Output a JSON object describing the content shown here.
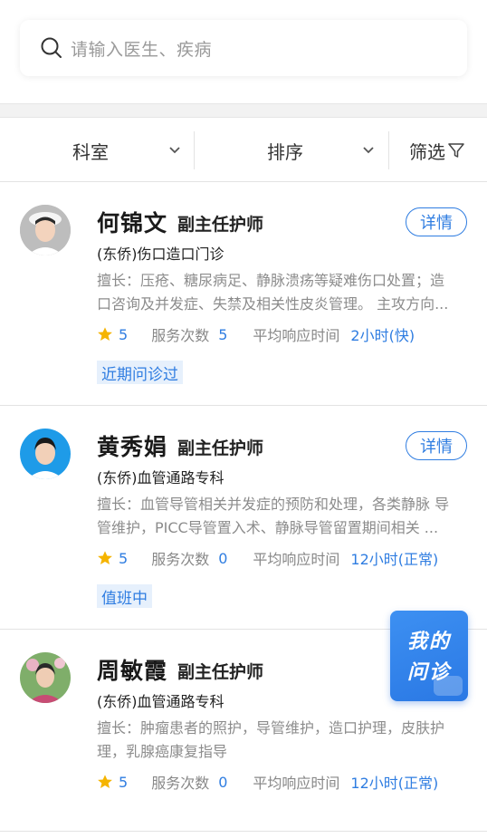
{
  "search": {
    "placeholder": "请输入医生、疾病",
    "icon": "search-icon"
  },
  "filters": {
    "department": "科室",
    "sort": "排序",
    "filter": "筛选"
  },
  "colors": {
    "accent": "#2f7de1",
    "tag_bg": "#e6f0fc",
    "star": "#f5b400"
  },
  "doctors": [
    {
      "name": "何锦文",
      "title": "副主任护师",
      "detail": "详情",
      "department": "(东侨)伤口造口门诊",
      "skill_line1": "擅长：压疮、糖尿病足、静脉溃疡等疑难伤口处置；造",
      "skill_line2": "口咨询及并发症、失禁及相关性皮炎管理。 主攻方向...",
      "rating": "5",
      "service_label": "服务次数",
      "service_count": "5",
      "response_label": "平均响应时间",
      "response_time": "2小时(快)",
      "tag": "近期问诊过"
    },
    {
      "name": "黄秀娟",
      "title": "副主任护师",
      "detail": "详情",
      "department": "(东侨)血管通路专科",
      "skill_line1": "擅长：血管导管相关并发症的预防和处理，各类静脉 导",
      "skill_line2": "管维护，PICC导管置入术、静脉导管留置期间相关 ...",
      "rating": "5",
      "service_label": "服务次数",
      "service_count": "0",
      "response_label": "平均响应时间",
      "response_time": "12小时(正常)",
      "tag": "值班中"
    },
    {
      "name": "周敏霞",
      "title": "副主任护师",
      "department": "(东侨)血管通路专科",
      "skill_line1": "擅长：肿瘤患者的照护，导管维护，造口护理，皮肤护",
      "skill_line2": "理，乳腺癌康复指导",
      "rating": "5",
      "service_label": "服务次数",
      "service_count": "0",
      "response_label": "平均响应时间",
      "response_time": "12小时(正常)"
    }
  ],
  "floating": {
    "line1": "我的",
    "line2": "问诊"
  }
}
